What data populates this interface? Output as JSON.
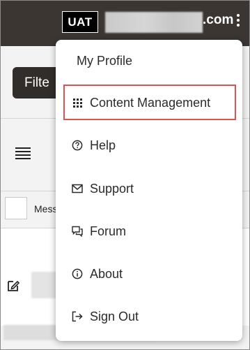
{
  "header": {
    "environment_badge": "UAT",
    "domain_suffix": ".com",
    "more_options": "more-vertical-icon"
  },
  "background": {
    "filter_button_label": "Filte",
    "message_column_header": "Mess"
  },
  "menu": {
    "items": [
      {
        "label": "My Profile",
        "icon": null
      },
      {
        "label": "Content Management",
        "icon": "grid-icon"
      },
      {
        "label": "Help",
        "icon": "help-circle-icon"
      },
      {
        "label": "Support",
        "icon": "mail-icon"
      },
      {
        "label": "Forum",
        "icon": "chat-icon"
      },
      {
        "label": "About",
        "icon": "info-icon"
      },
      {
        "label": "Sign Out",
        "icon": "sign-out-icon"
      }
    ],
    "highlighted_item": "Content Management"
  },
  "colors": {
    "header_bg": "#3b3632",
    "highlight_border": "#e0524e",
    "filter_button_bg": "#312d2a"
  }
}
